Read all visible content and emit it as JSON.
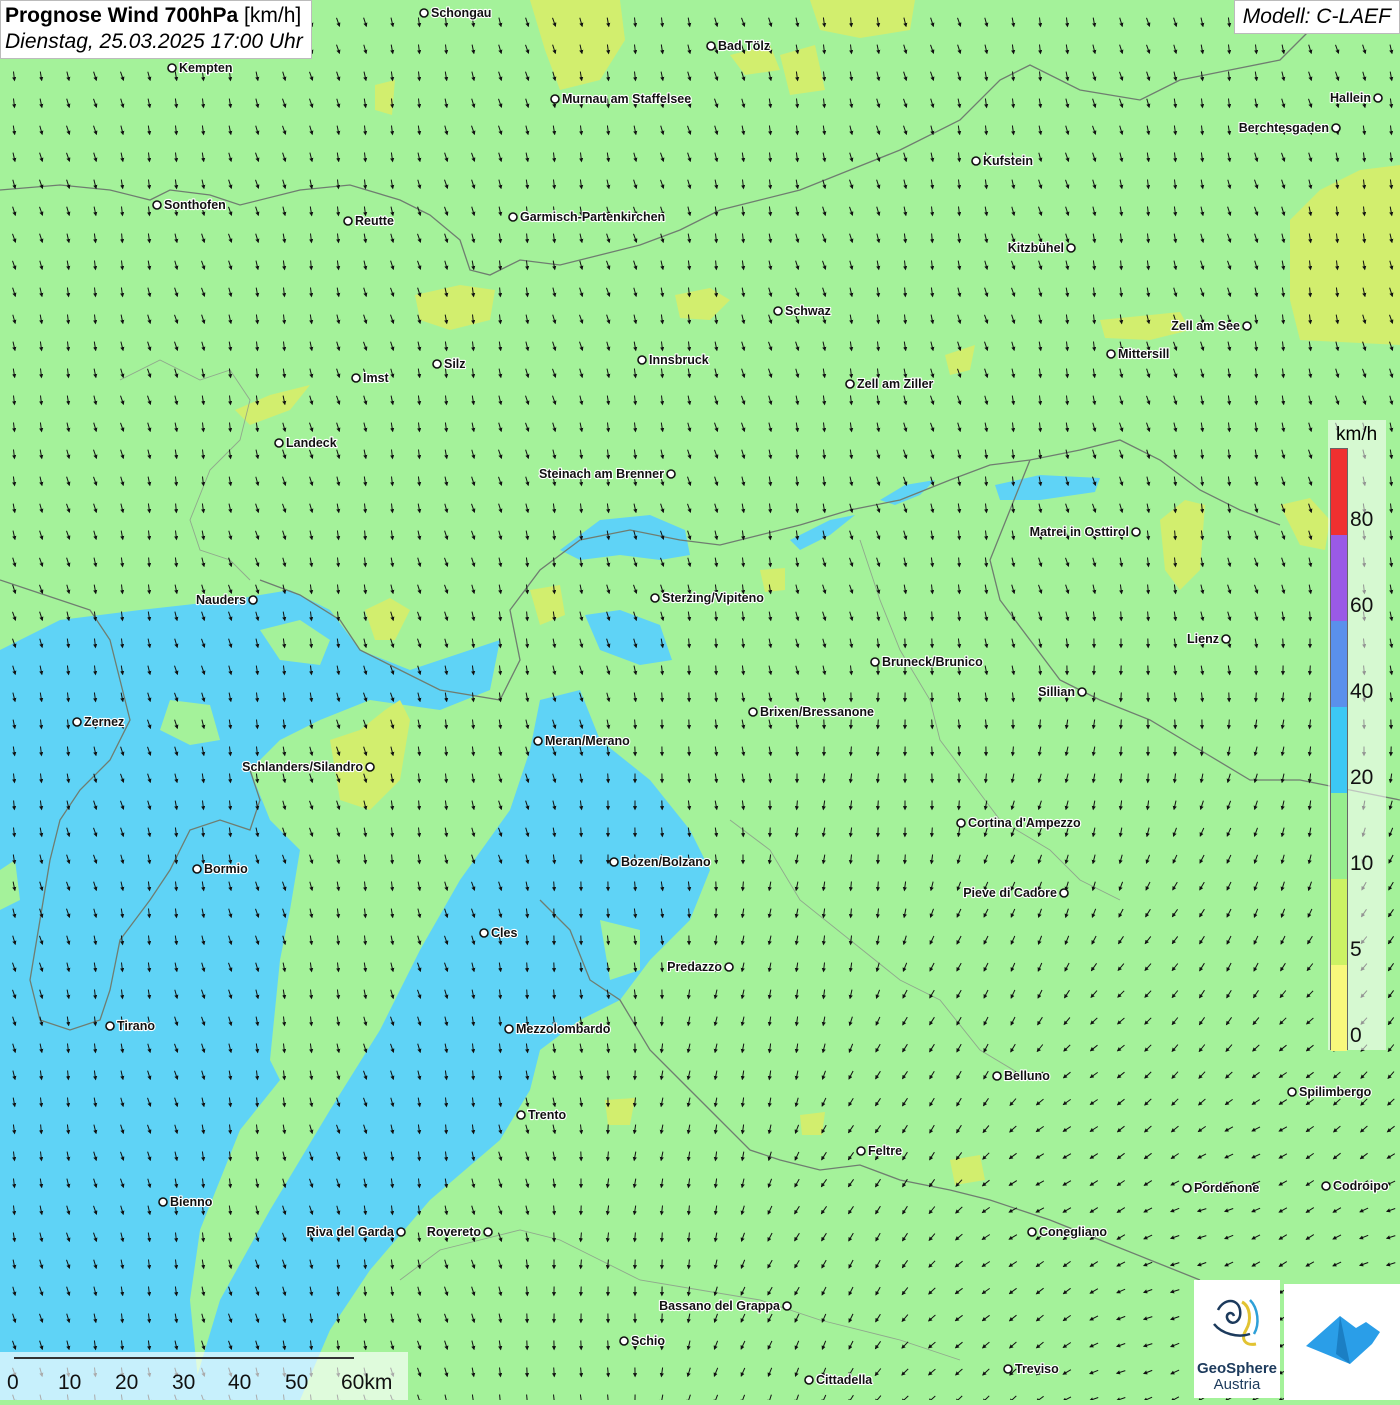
{
  "title": {
    "main": "Prognose Wind 700hPa",
    "unit": "[km/h]",
    "datetime": "Dienstag, 25.03.2025 17:00 Uhr"
  },
  "model": "Modell: C-LAEF",
  "legend": {
    "unit": "km/h",
    "ticks": [
      "80",
      "60",
      "40",
      "20",
      "10",
      "5",
      "0"
    ],
    "colors": [
      "#f03030",
      "#9a5ae6",
      "#5a90ec",
      "#3cc8f4",
      "#96ee8e",
      "#ccf264",
      "#f8f87c"
    ]
  },
  "scale": {
    "labels": [
      "0",
      "10",
      "20",
      "30",
      "40",
      "50",
      "60km"
    ]
  },
  "logos": {
    "geosphere_line1": "GeoSphere",
    "geosphere_line2": "Austria",
    "geosphere_icon": "geosphere-logo-icon",
    "basemap_icon": "basemap-logo-icon"
  },
  "cities": [
    {
      "name": "Schongau"
    },
    {
      "name": "Kempten"
    },
    {
      "name": "Bad Tölz"
    },
    {
      "name": "Murnau am Staffelsee"
    },
    {
      "name": "Hallein"
    },
    {
      "name": "Berchtesgaden"
    },
    {
      "name": "Kufstein"
    },
    {
      "name": "Sonthofen"
    },
    {
      "name": "Reutte"
    },
    {
      "name": "Garmisch-Partenkirchen"
    },
    {
      "name": "Kitzbühel"
    },
    {
      "name": "Schwaz"
    },
    {
      "name": "Zell am See"
    },
    {
      "name": "Mittersill"
    },
    {
      "name": "Innsbruck"
    },
    {
      "name": "Silz"
    },
    {
      "name": "Imst"
    },
    {
      "name": "Zell am Ziller"
    },
    {
      "name": "Landeck"
    },
    {
      "name": "Steinach am Brenner"
    },
    {
      "name": "Matrei in Osttirol"
    },
    {
      "name": "Nauders"
    },
    {
      "name": "Sterzing/Vipiteno"
    },
    {
      "name": "Lienz"
    },
    {
      "name": "Bruneck/Brunico"
    },
    {
      "name": "Sillian"
    },
    {
      "name": "Zernez"
    },
    {
      "name": "Brixen/Bressanone"
    },
    {
      "name": "Meran/Merano"
    },
    {
      "name": "Schlanders/Silandro"
    },
    {
      "name": "Cortina d'Ampezzo"
    },
    {
      "name": "Bozen/Bolzano"
    },
    {
      "name": "Bormio"
    },
    {
      "name": "Pieve di Cadore"
    },
    {
      "name": "Cles"
    },
    {
      "name": "Predazzo"
    },
    {
      "name": "Tirano"
    },
    {
      "name": "Mezzolombardo"
    },
    {
      "name": "Belluno"
    },
    {
      "name": "Spilimbergo"
    },
    {
      "name": "Trento"
    },
    {
      "name": "Feltre"
    },
    {
      "name": "Pordenone"
    },
    {
      "name": "Codroipo"
    },
    {
      "name": "Bienno"
    },
    {
      "name": "Riva del Garda"
    },
    {
      "name": "Rovereto"
    },
    {
      "name": "Conegliano"
    },
    {
      "name": "Bassano del Grappa"
    },
    {
      "name": "Schio"
    },
    {
      "name": "Treviso"
    },
    {
      "name": "Cittadella"
    }
  ]
}
